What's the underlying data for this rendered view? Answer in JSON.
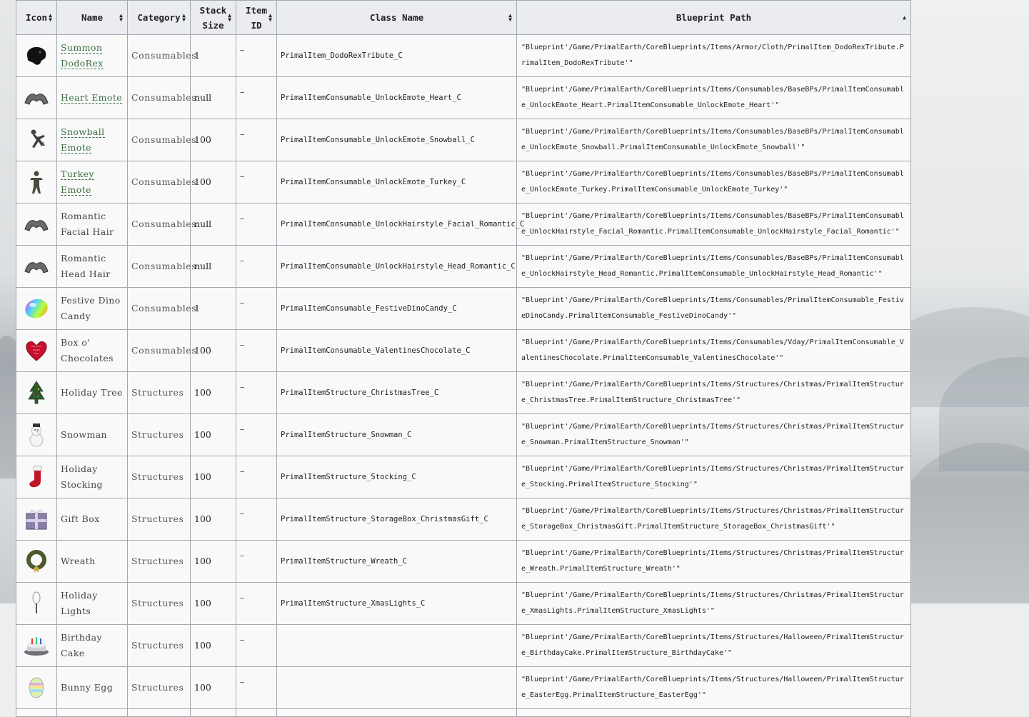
{
  "columns": [
    {
      "key": "icon",
      "label": "Icon",
      "sort": "both"
    },
    {
      "key": "name",
      "label": "Name",
      "sort": "both"
    },
    {
      "key": "category",
      "label": "Category",
      "sort": "both"
    },
    {
      "key": "stack",
      "label": "Stack Size",
      "sort": "both"
    },
    {
      "key": "item_id",
      "label": "Item ID",
      "sort": "both"
    },
    {
      "key": "class_name",
      "label": "Class Name",
      "sort": "both"
    },
    {
      "key": "blueprint",
      "label": "Blueprint Path",
      "sort": "ascending"
    }
  ],
  "rows": [
    {
      "icon": "dodorex-head-icon",
      "name": "Summon DodoRex",
      "link": true,
      "category": "Consumables",
      "stack": "1",
      "item_id": "–",
      "class_name": "PrimalItem_DodoRexTribute_C",
      "blueprint": "\"Blueprint'/Game/PrimalEarth/CoreBlueprints/Items/Armor/Cloth/PrimalItem_DodoRexTribute.PrimalItem_DodoRexTribute'\""
    },
    {
      "icon": "emote-hands-icon",
      "name": "Heart Emote",
      "link": true,
      "category": "Consumables",
      "stack": "null",
      "item_id": "–",
      "class_name": "PrimalItemConsumable_UnlockEmote_Heart_C",
      "blueprint": "\"Blueprint'/Game/PrimalEarth/CoreBlueprints/Items/Consumables/BaseBPs/PrimalItemConsumable_UnlockEmote_Heart.PrimalItemConsumable_UnlockEmote_Heart'\""
    },
    {
      "icon": "snowball-emote-icon",
      "name": "Snowball Emote",
      "link": true,
      "category": "Consumables",
      "stack": "100",
      "item_id": "–",
      "class_name": "PrimalItemConsumable_UnlockEmote_Snowball_C",
      "blueprint": "\"Blueprint'/Game/PrimalEarth/CoreBlueprints/Items/Consumables/BaseBPs/PrimalItemConsumable_UnlockEmote_Snowball.PrimalItemConsumable_UnlockEmote_Snowball'\""
    },
    {
      "icon": "turkey-emote-icon",
      "name": "Turkey Emote",
      "link": true,
      "category": "Consumables",
      "stack": "100",
      "item_id": "–",
      "class_name": "PrimalItemConsumable_UnlockEmote_Turkey_C",
      "blueprint": "\"Blueprint'/Game/PrimalEarth/CoreBlueprints/Items/Consumables/BaseBPs/PrimalItemConsumable_UnlockEmote_Turkey.PrimalItemConsumable_UnlockEmote_Turkey'\""
    },
    {
      "icon": "emote-hands-icon",
      "name": "Romantic Facial Hair",
      "link": false,
      "category": "Consumables",
      "stack": "null",
      "item_id": "–",
      "class_name": "PrimalItemConsumable_UnlockHairstyle_Facial_Romantic_C",
      "blueprint": "\"Blueprint'/Game/PrimalEarth/CoreBlueprints/Items/Consumables/BaseBPs/PrimalItemConsumable_UnlockHairstyle_Facial_Romantic.PrimalItemConsumable_UnlockHairstyle_Facial_Romantic'\""
    },
    {
      "icon": "emote-hands-icon",
      "name": "Romantic Head Hair",
      "link": false,
      "category": "Consumables",
      "stack": "null",
      "item_id": "–",
      "class_name": "PrimalItemConsumable_UnlockHairstyle_Head_Romantic_C",
      "blueprint": "\"Blueprint'/Game/PrimalEarth/CoreBlueprints/Items/Consumables/BaseBPs/PrimalItemConsumable_UnlockHairstyle_Head_Romantic.PrimalItemConsumable_UnlockHairstyle_Head_Romantic'\""
    },
    {
      "icon": "candy-icon",
      "name": "Festive Dino Candy",
      "link": false,
      "category": "Consumables",
      "stack": "1",
      "item_id": "–",
      "class_name": "PrimalItemConsumable_FestiveDinoCandy_C",
      "blueprint": "\"Blueprint'/Game/PrimalEarth/CoreBlueprints/Items/Consumables/PrimalItemConsumable_FestiveDinoCandy.PrimalItemConsumable_FestiveDinoCandy'\""
    },
    {
      "icon": "heart-box-icon",
      "name": "Box o' Chocolates",
      "link": false,
      "category": "Consumables",
      "stack": "100",
      "item_id": "–",
      "class_name": "PrimalItemConsumable_ValentinesChocolate_C",
      "blueprint": "\"Blueprint'/Game/PrimalEarth/CoreBlueprints/Items/Consumables/Vday/PrimalItemConsumable_ValentinesChocolate.PrimalItemConsumable_ValentinesChocolate'\""
    },
    {
      "icon": "christmas-tree-icon",
      "name": "Holiday Tree",
      "link": false,
      "category": "Structures",
      "stack": "100",
      "item_id": "–",
      "class_name": "PrimalItemStructure_ChristmasTree_C",
      "blueprint": "\"Blueprint'/Game/PrimalEarth/CoreBlueprints/Items/Structures/Christmas/PrimalItemStructure_ChristmasTree.PrimalItemStructure_ChristmasTree'\""
    },
    {
      "icon": "snowman-icon",
      "name": "Snowman",
      "link": false,
      "category": "Structures",
      "stack": "100",
      "item_id": "–",
      "class_name": "PrimalItemStructure_Snowman_C",
      "blueprint": "\"Blueprint'/Game/PrimalEarth/CoreBlueprints/Items/Structures/Christmas/PrimalItemStructure_Snowman.PrimalItemStructure_Snowman'\""
    },
    {
      "icon": "stocking-icon",
      "name": "Holiday Stocking",
      "link": false,
      "category": "Structures",
      "stack": "100",
      "item_id": "–",
      "class_name": "PrimalItemStructure_Stocking_C",
      "blueprint": "\"Blueprint'/Game/PrimalEarth/CoreBlueprints/Items/Structures/Christmas/PrimalItemStructure_Stocking.PrimalItemStructure_Stocking'\""
    },
    {
      "icon": "gift-box-icon",
      "name": "Gift Box",
      "link": false,
      "category": "Structures",
      "stack": "100",
      "item_id": "–",
      "class_name": "PrimalItemStructure_StorageBox_ChristmasGift_C",
      "blueprint": "\"Blueprint'/Game/PrimalEarth/CoreBlueprints/Items/Structures/Christmas/PrimalItemStructure_StorageBox_ChristmasGift.PrimalItemStructure_StorageBox_ChristmasGift'\""
    },
    {
      "icon": "wreath-icon",
      "name": "Wreath",
      "link": false,
      "category": "Structures",
      "stack": "100",
      "item_id": "–",
      "class_name": "PrimalItemStructure_Wreath_C",
      "blueprint": "\"Blueprint'/Game/PrimalEarth/CoreBlueprints/Items/Structures/Christmas/PrimalItemStructure_Wreath.PrimalItemStructure_Wreath'\""
    },
    {
      "icon": "lights-icon",
      "name": "Holiday Lights",
      "link": false,
      "category": "Structures",
      "stack": "100",
      "item_id": "–",
      "class_name": "PrimalItemStructure_XmasLights_C",
      "blueprint": "\"Blueprint'/Game/PrimalEarth/CoreBlueprints/Items/Structures/Christmas/PrimalItemStructure_XmasLights.PrimalItemStructure_XmasLights'\""
    },
    {
      "icon": "birthday-cake-icon",
      "name": "Birthday Cake",
      "link": false,
      "category": "Structures",
      "stack": "100",
      "item_id": "–",
      "class_name": "",
      "blueprint": "\"Blueprint'/Game/PrimalEarth/CoreBlueprints/Items/Structures/Halloween/PrimalItemStructure_BirthdayCake.PrimalItemStructure_BirthdayCake'\""
    },
    {
      "icon": "easter-egg-icon",
      "name": "Bunny Egg",
      "link": false,
      "category": "Structures",
      "stack": "100",
      "item_id": "–",
      "class_name": "",
      "blueprint": "\"Blueprint'/Game/PrimalEarth/CoreBlueprints/Items/Structures/Halloween/PrimalItemStructure_EasterEgg.PrimalItemStructure_EasterEgg'\""
    }
  ]
}
